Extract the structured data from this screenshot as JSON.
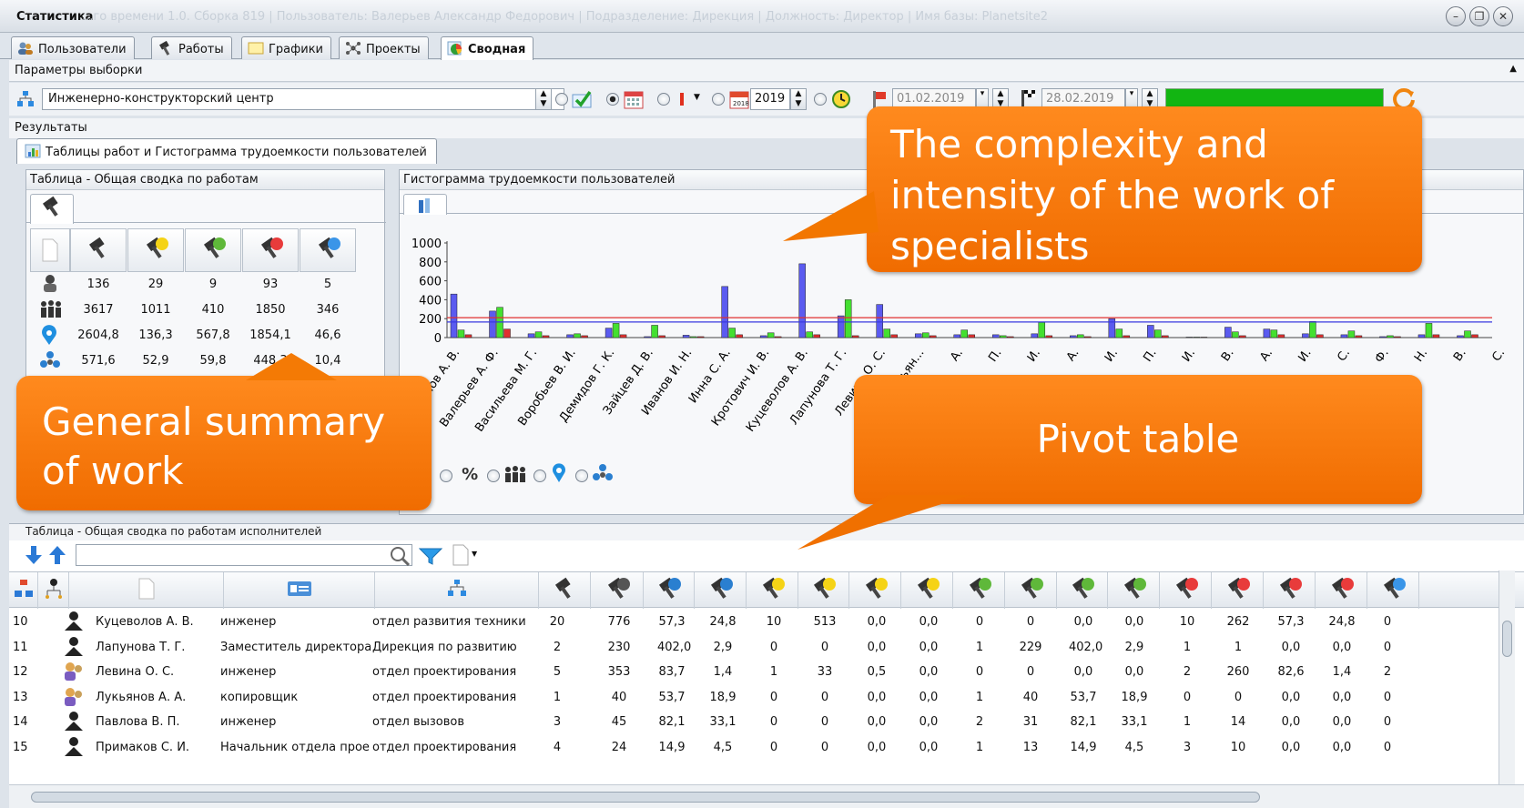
{
  "window": {
    "title": "Статистика",
    "ghost_title": "...го времени 1.0. Сборка 819 | Пользователь: Валерьев Александр Федорович | Подразделение: Дирекция | Должность: Директор | Имя базы: Planetsite2"
  },
  "tabs": [
    {
      "label": "Пользователи",
      "icon": "users-icon"
    },
    {
      "label": "Работы",
      "icon": "hammer-icon"
    },
    {
      "label": "Графики",
      "icon": "chart-icon"
    },
    {
      "label": "Проекты",
      "icon": "network-icon"
    },
    {
      "label": "Сводная",
      "icon": "pie-icon",
      "active": true
    }
  ],
  "params": {
    "label": "Параметры выборки",
    "department": "Инженерно-конструкторский центр",
    "year": "2019",
    "date_from": "01.02.2019",
    "date_to": "28.02.2019",
    "progress": 1.0,
    "progress_color": "#12b512"
  },
  "results": {
    "label": "Результаты",
    "subtab": "Таблицы работ и Гистограмма трудоемкости пользователей"
  },
  "summary": {
    "title": "Таблица - Общая сводка по работам",
    "rows": [
      {
        "icon": "workers-icon",
        "values": [
          "136",
          "29",
          "9",
          "93",
          "5"
        ]
      },
      {
        "icon": "people-icon",
        "values": [
          "3617",
          "1011",
          "410",
          "1850",
          "346"
        ]
      },
      {
        "icon": "pin-icon",
        "values": [
          "2604,8",
          "136,3",
          "567,8",
          "1854,1",
          "46,6"
        ]
      },
      {
        "icon": "group-icon",
        "values": [
          "571,6",
          "52,9",
          "59,8",
          "448,3",
          "10,4"
        ]
      }
    ]
  },
  "chart": {
    "title": "Гистограмма трудоемкости пользователей",
    "bottom_symbol": "%"
  },
  "chart_data": {
    "type": "bar",
    "title": "",
    "ylim": [
      0,
      1000
    ],
    "yticks": [
      0,
      200,
      400,
      600,
      800,
      1000
    ],
    "categories": [
      "...рганов А. В.",
      "Валерьев А. Ф.",
      "Васильева М. Г.",
      "Воробьев В. И.",
      "Демидов Г. К.",
      "Зайцев Д. В.",
      "Иванов И. Н.",
      "Инна С. А.",
      "Кротович И. В.",
      "Куцеволов А. В.",
      "Лапунова Т. Г.",
      "Левина О. С.",
      "Лукьян...",
      "А.",
      "П.",
      "И.",
      "А.",
      "И.",
      "П.",
      "И.",
      "В.",
      "А.",
      "И.",
      "С.",
      "Ф.",
      "Н.",
      "В.",
      "С."
    ],
    "series": [
      {
        "color": "#5b5bf0",
        "values": [
          460,
          280,
          40,
          30,
          100,
          10,
          25,
          540,
          20,
          780,
          230,
          350,
          40,
          30,
          30,
          40,
          20,
          200,
          130,
          5,
          110,
          90,
          40,
          30,
          10,
          30,
          20
        ]
      },
      {
        "color": "#44e030",
        "values": [
          80,
          320,
          60,
          40,
          150,
          130,
          10,
          100,
          50,
          60,
          400,
          90,
          50,
          80,
          20,
          160,
          30,
          90,
          80,
          5,
          60,
          80,
          170,
          70,
          20,
          150,
          70
        ]
      },
      {
        "color": "#e03030",
        "values": [
          30,
          90,
          20,
          20,
          30,
          20,
          10,
          30,
          10,
          30,
          20,
          30,
          20,
          30,
          10,
          20,
          10,
          20,
          20,
          5,
          20,
          30,
          30,
          20,
          10,
          30,
          30
        ]
      }
    ],
    "reference_lines": [
      {
        "value": 210,
        "color": "#e03030"
      },
      {
        "value": 165,
        "color": "#3838e0"
      }
    ]
  },
  "callouts": {
    "complexity": "The complexity and intensity of the work of specialists",
    "summary": "General summary of work",
    "pivot": "Pivot table"
  },
  "pivot": {
    "title": "Таблица - Общая сводка по работам исполнителей",
    "rows": [
      {
        "n": "10",
        "name": "Куцеволов А. В.",
        "role": "инженер",
        "dept": "отдел развития техники",
        "cells": [
          "20",
          "776",
          "57,3",
          "24,8",
          "10",
          "513",
          "0,0",
          "0,0",
          "0",
          "0",
          "0,0",
          "0,0",
          "10",
          "262",
          "57,3",
          "24,8",
          "0"
        ]
      },
      {
        "n": "11",
        "name": "Лапунова Т. Г.",
        "role": "Заместитель директора",
        "dept": "Дирекция по развитию",
        "cells": [
          "2",
          "230",
          "402,0",
          "2,9",
          "0",
          "0",
          "0,0",
          "0,0",
          "1",
          "229",
          "402,0",
          "2,9",
          "1",
          "1",
          "0,0",
          "0,0",
          "0"
        ]
      },
      {
        "n": "12",
        "name": "Левина О. С.",
        "role": "инженер",
        "dept": "отдел проектирования",
        "cells": [
          "5",
          "353",
          "83,7",
          "1,4",
          "1",
          "33",
          "0,5",
          "0,0",
          "0",
          "0",
          "0,0",
          "0,0",
          "2",
          "260",
          "82,6",
          "1,4",
          "2"
        ]
      },
      {
        "n": "13",
        "name": "Лукьянов А. А.",
        "role": "копировщик",
        "dept": "отдел проектирования",
        "cells": [
          "1",
          "40",
          "53,7",
          "18,9",
          "0",
          "0",
          "0,0",
          "0,0",
          "1",
          "40",
          "53,7",
          "18,9",
          "0",
          "0",
          "0,0",
          "0,0",
          "0"
        ]
      },
      {
        "n": "14",
        "name": "Павлова В. П.",
        "role": "инженер",
        "dept": "отдел вызовов",
        "cells": [
          "3",
          "45",
          "82,1",
          "33,1",
          "0",
          "0",
          "0,0",
          "0,0",
          "2",
          "31",
          "82,1",
          "33,1",
          "1",
          "14",
          "0,0",
          "0,0",
          "0"
        ]
      },
      {
        "n": "15",
        "name": "Примаков С. И.",
        "role": "Начальник отдела прое",
        "dept": "отдел проектирования",
        "cells": [
          "4",
          "24",
          "14,9",
          "4,5",
          "0",
          "0",
          "0,0",
          "0,0",
          "1",
          "13",
          "14,9",
          "4,5",
          "3",
          "10",
          "0,0",
          "0,0",
          "0"
        ]
      }
    ]
  }
}
